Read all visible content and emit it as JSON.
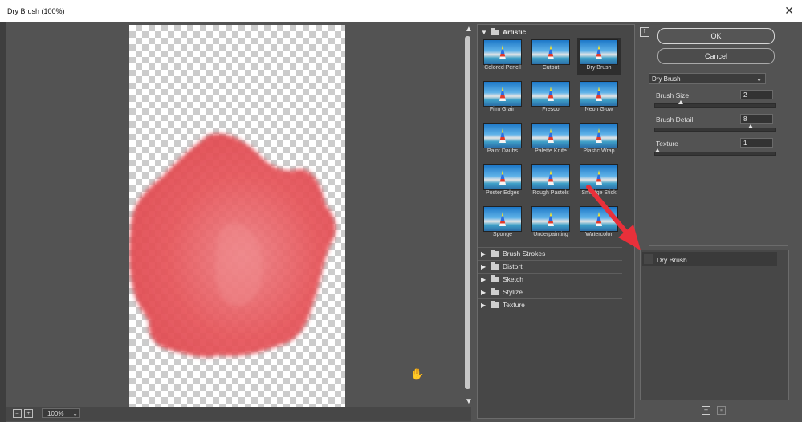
{
  "window": {
    "title": "Dry Brush (100%)",
    "close_label": "✕"
  },
  "preview": {
    "zoom": "100%"
  },
  "gallery": {
    "open_category": "Artistic",
    "filters": [
      {
        "label": "Colored Pencil"
      },
      {
        "label": "Cutout"
      },
      {
        "label": "Dry Brush",
        "selected": true
      },
      {
        "label": "Film Grain"
      },
      {
        "label": "Fresco"
      },
      {
        "label": "Neon Glow"
      },
      {
        "label": "Paint Daubs"
      },
      {
        "label": "Palette Knife"
      },
      {
        "label": "Plastic Wrap"
      },
      {
        "label": "Poster Edges"
      },
      {
        "label": "Rough Pastels"
      },
      {
        "label": "Smudge Stick"
      },
      {
        "label": "Sponge"
      },
      {
        "label": "Underpainting"
      },
      {
        "label": "Watercolor"
      }
    ],
    "categories": [
      "Brush Strokes",
      "Distort",
      "Sketch",
      "Stylize",
      "Texture"
    ]
  },
  "buttons": {
    "ok": "OK",
    "cancel": "Cancel"
  },
  "settings": {
    "filter_select": "Dry Brush",
    "params": [
      {
        "label": "Brush Size",
        "value": "2",
        "fraction": 0.2
      },
      {
        "label": "Brush Detail",
        "value": "8",
        "fraction": 0.8
      },
      {
        "label": "Texture",
        "value": "1",
        "fraction": 0.0
      }
    ]
  },
  "layers": {
    "items": [
      "Dry Brush"
    ]
  },
  "colors": {
    "paint": "#e0484f",
    "annotation_arrow": "#e8303a"
  }
}
